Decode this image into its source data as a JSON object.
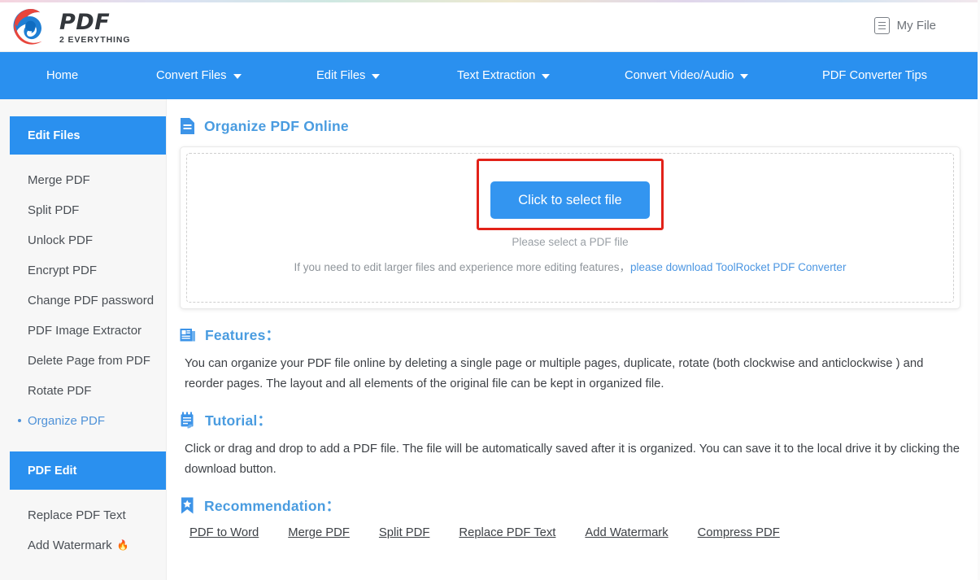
{
  "header": {
    "logo_text": "PDF",
    "logo_sub": "2 EVERYTHING",
    "myfile_label": "My File"
  },
  "nav": {
    "items": [
      {
        "label": "Home",
        "caret": false
      },
      {
        "label": "Convert Files",
        "caret": true
      },
      {
        "label": "Edit Files",
        "caret": true
      },
      {
        "label": "Text Extraction",
        "caret": true
      },
      {
        "label": "Convert Video/Audio",
        "caret": true
      },
      {
        "label": "PDF Converter Tips",
        "caret": false
      }
    ]
  },
  "sidebar": {
    "group1_title": "Edit Files",
    "group1_items": [
      {
        "label": "Merge PDF",
        "active": false
      },
      {
        "label": "Split PDF",
        "active": false
      },
      {
        "label": "Unlock PDF",
        "active": false
      },
      {
        "label": "Encrypt PDF",
        "active": false
      },
      {
        "label": "Change PDF password",
        "active": false
      },
      {
        "label": "PDF Image Extractor",
        "active": false
      },
      {
        "label": "Delete Page from PDF",
        "active": false
      },
      {
        "label": "Rotate PDF",
        "active": false
      },
      {
        "label": "Organize PDF",
        "active": true
      }
    ],
    "group2_title": "PDF Edit",
    "group2_items": [
      {
        "label": "Replace PDF Text",
        "hot": false
      },
      {
        "label": "Add Watermark",
        "hot": true
      }
    ]
  },
  "main": {
    "page_title": "Organize PDF Online",
    "upload": {
      "button_label": "Click to select file",
      "hint": "Please select a PDF file",
      "hint2_prefix": "If you need to edit larger files and experience more editing features，",
      "hint2_link": "please download ToolRocket PDF Converter"
    },
    "features": {
      "title": "Features：",
      "text": "You can organize your PDF file online by deleting a single page or multiple pages, duplicate, rotate (both clockwise and anticlockwise ) and reorder pages. The layout and all elements of the original file can be kept in organized file."
    },
    "tutorial": {
      "title": "Tutorial：",
      "text": "Click or drag and drop to add a PDF file. The file will be automatically saved after it is organized. You can save it to the local drive it by clicking the download button."
    },
    "recommendation": {
      "title": "Recommendation：",
      "links": [
        "PDF to Word",
        "Merge PDF",
        "Split PDF",
        "Replace PDF Text",
        "Add Watermark",
        "Compress PDF"
      ]
    }
  },
  "colors": {
    "brand_blue": "#2a90ef",
    "accent_blue": "#4a9ce0",
    "annotation_red": "#e22219",
    "hot_orange": "#f08229"
  }
}
